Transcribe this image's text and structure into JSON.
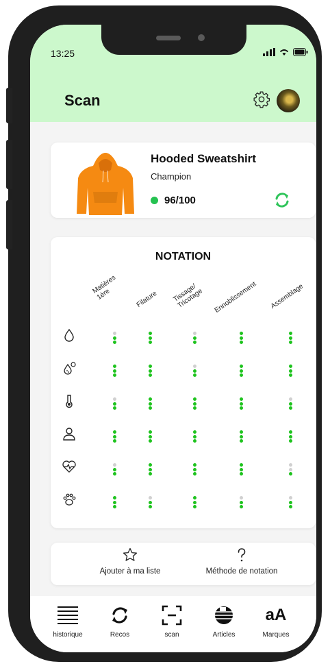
{
  "status_bar": {
    "time": "13:25"
  },
  "header": {
    "title": "Scan"
  },
  "product": {
    "name": "Hooded Sweatshirt",
    "brand": "Champion",
    "score": "96/100"
  },
  "notation": {
    "title": "NOTATION",
    "columns": [
      "Matières\n1ère",
      "Filature",
      "Tissage/\nTricotage",
      "Ennoblissement",
      "Assemblage"
    ],
    "row_icons": [
      "water-drop-icon",
      "chemical-drop-icon",
      "thermometer-icon",
      "person-icon",
      "heartbeat-icon",
      "paw-icon"
    ],
    "ratings_out_of_3": [
      [
        2,
        3,
        2,
        3,
        3
      ],
      [
        3,
        3,
        2,
        3,
        3
      ],
      [
        2,
        3,
        3,
        3,
        2
      ],
      [
        3,
        3,
        3,
        3,
        3
      ],
      [
        2,
        3,
        3,
        3,
        1
      ],
      [
        3,
        2,
        3,
        2,
        2
      ]
    ]
  },
  "actions": {
    "add_to_list": "Ajouter à ma liste",
    "method": "Méthode de notation"
  },
  "nav": {
    "history": "historique",
    "recos": "Recos",
    "scan": "scan",
    "articles": "Articles",
    "brands": "Marques",
    "brands_icon_text": "aA"
  },
  "colors": {
    "header_bg": "#ccf8cc",
    "score_green": "#25c251",
    "rating_on": "#1ec31e",
    "rating_off": "#d0d0d0"
  }
}
